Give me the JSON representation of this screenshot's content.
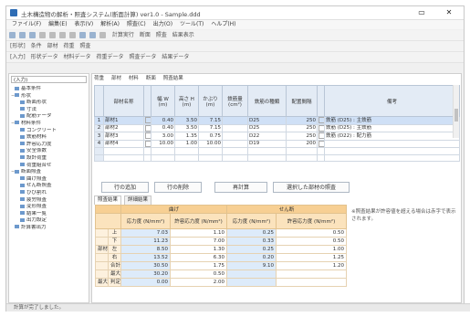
{
  "window": {
    "title": "土木構造物の解析・照査システム(断面計算) ver1.0 - Sample.ddd",
    "min_glyph": "▭",
    "close_glyph": "✕"
  },
  "menu": [
    "ファイル(F)",
    "編集(E)",
    "表示(V)",
    "解析(A)",
    "照査(C)",
    "出力(O)",
    "ツール(T)",
    "ヘルプ(H)"
  ],
  "toolbar2_labels": [
    "計算実行",
    "断面",
    "照査",
    "結果表示"
  ],
  "toolbar3_labels": [
    "[形状]",
    "条件",
    "部材",
    "荷重",
    "照査"
  ],
  "toolbar4_labels": [
    "[入力]",
    "形状データ",
    "材料データ",
    "荷重データ",
    "照査データ",
    "結果データ"
  ],
  "left_combo": "(入力)",
  "tree": [
    {
      "exp": "",
      "label": "基本条件",
      "indent": 0
    },
    {
      "exp": "−",
      "label": "形状",
      "indent": 0
    },
    {
      "exp": "",
      "label": "断面形状",
      "indent": 1
    },
    {
      "exp": "",
      "label": "寸法",
      "indent": 1
    },
    {
      "exp": "",
      "label": "配筋データ",
      "indent": 1
    },
    {
      "exp": "−",
      "label": "材料条件",
      "indent": 0
    },
    {
      "exp": "",
      "label": "コンクリート",
      "indent": 1
    },
    {
      "exp": "",
      "label": "鉄筋材料",
      "indent": 1
    },
    {
      "exp": "",
      "label": "許容応力度",
      "indent": 1
    },
    {
      "exp": "",
      "label": "安全係数",
      "indent": 1
    },
    {
      "exp": "",
      "label": "設計荷重",
      "indent": 1
    },
    {
      "exp": "",
      "label": "荷重組合せ",
      "indent": 1
    },
    {
      "exp": "−",
      "label": "断面照査",
      "indent": 0
    },
    {
      "exp": "",
      "label": "曲げ照査",
      "indent": 1
    },
    {
      "exp": "",
      "label": "せん断照査",
      "indent": 1
    },
    {
      "exp": "",
      "label": "ひび割れ",
      "indent": 1
    },
    {
      "exp": "",
      "label": "疲労照査",
      "indent": 1
    },
    {
      "exp": "",
      "label": "変形照査",
      "indent": 1
    },
    {
      "exp": "",
      "label": "結果一覧",
      "indent": 1
    },
    {
      "exp": "",
      "label": "出力設定",
      "indent": 1
    },
    {
      "exp": "",
      "label": "計算書出力",
      "indent": 0
    }
  ],
  "subtabs": [
    "荷重",
    "部材",
    "材料",
    "断面",
    "照査結果"
  ],
  "grid1": {
    "headers": [
      "",
      "部材名称",
      "",
      "幅 W (m)",
      "高さ H (m)",
      "かぶり (m)",
      "鉄筋量 (cm²)",
      "鉄筋の種類",
      "配置間隔",
      "",
      "備考"
    ],
    "rows": [
      [
        "1",
        "部材1",
        "",
        "0.40",
        "3.50",
        "7.15",
        "",
        "D25",
        "250",
        "",
        "鉄筋 (D25) : 主鉄筋"
      ],
      [
        "2",
        "部材2",
        "",
        "0.40",
        "3.50",
        "7.15",
        "",
        "D25",
        "250",
        "",
        "鉄筋 (D25) : 主鉄筋"
      ],
      [
        "3",
        "部材3",
        "",
        "3.00",
        "1.35",
        "0.75",
        "",
        "D22",
        "250",
        "",
        "鉄筋 (D22) : 配力筋"
      ],
      [
        "4",
        "部材4",
        "",
        "10.00",
        "1.00",
        "10.00",
        "",
        "D19",
        "200",
        "",
        ""
      ]
    ]
  },
  "buttons": {
    "add": "行の追加",
    "delete": "行の削除",
    "calc": "再計算",
    "check": "選択した部材の照査"
  },
  "tabs2": [
    "照査結果",
    "詳細結果"
  ],
  "grid2": {
    "group1": "曲げ",
    "group2": "せん断",
    "sub": [
      "応力度 (N/mm²)",
      "許容応力度 (N/mm²)",
      "応力度 (N/mm²)",
      "許容応力度 (N/mm²)"
    ],
    "rows": [
      {
        "g": "",
        "s": "上",
        "v": [
          "7.03",
          "1.10",
          "0.25",
          "0.50"
        ]
      },
      {
        "g": "",
        "s": "下",
        "v": [
          "11.23",
          "7.00",
          "0.33",
          "0.50"
        ]
      },
      {
        "g": "部材",
        "s": "左",
        "v": [
          "8.50",
          "1.30",
          "0.25",
          "1.00"
        ]
      },
      {
        "g": "",
        "s": "右",
        "v": [
          "13.52",
          "6.30",
          "0.20",
          "1.25"
        ]
      },
      {
        "g": "",
        "s": "合計",
        "v": [
          "30.50",
          "1.75",
          "9.10",
          "1.20"
        ]
      },
      {
        "g": "",
        "s": "最大",
        "v": [
          "30.20",
          "0.50",
          "",
          ""
        ]
      },
      {
        "g": "最大",
        "s": "判定",
        "v": [
          "0.00",
          "2.00",
          "",
          ""
        ]
      }
    ]
  },
  "note": "※照査結果が許容値を超える場合は赤字で表示されます。",
  "status": "計算が完了しました。"
}
